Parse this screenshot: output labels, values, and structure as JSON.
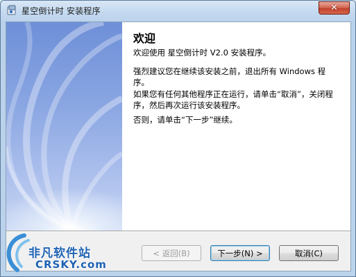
{
  "window": {
    "title": "星空倒计时 安装程序",
    "close_label": "✕"
  },
  "welcome": {
    "heading": "欢迎",
    "line1": "欢迎使用 星空倒计时 V2.0 安装程序。",
    "line2": "强烈建议您在继续该安装之前，退出所有 Windows 程序。",
    "line3": "如果您有任何其他程序正在运行，请单击“取消”，关闭程序，然后再次运行该安装程序。",
    "line4": "否则，请单击“下一步”继续。"
  },
  "buttons": {
    "back": "< 返回(B)",
    "next": "下一步(N) >",
    "cancel": "取消(C)"
  },
  "watermark": {
    "cn": "非凡软件站",
    "en": "CRSKY.com"
  },
  "colors": {
    "accent": "#3c7fb1",
    "panel": "#8aa6e2",
    "close": "#c0432e",
    "logo": "#1f63b3"
  }
}
